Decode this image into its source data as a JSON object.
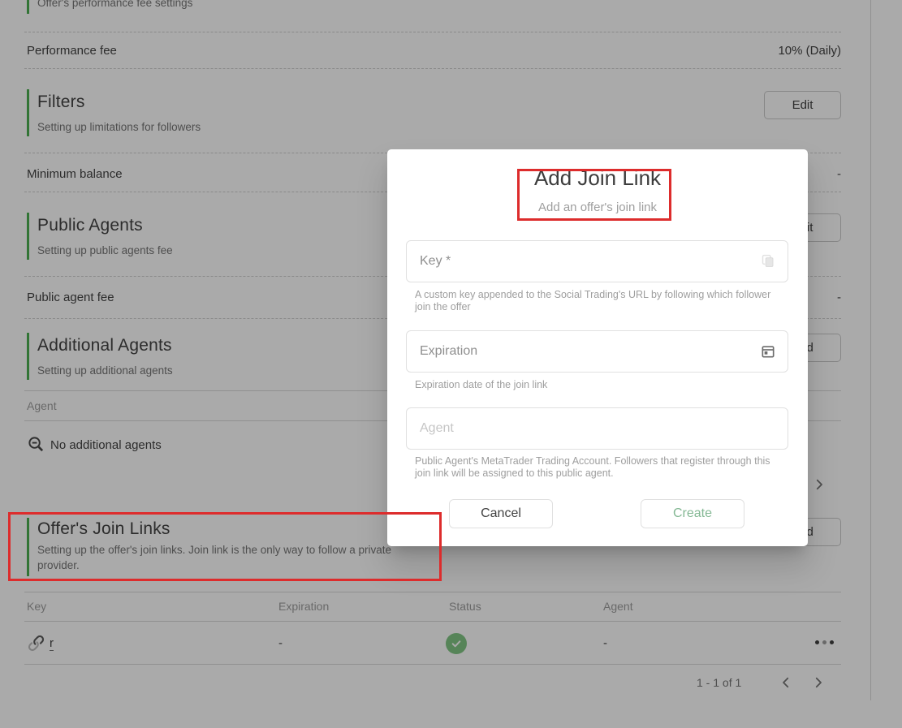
{
  "colors": {
    "section_accent_green": "#4caf50",
    "annotation_red": "#dd2c2c",
    "create_button_green": "#84b894",
    "status_check_green": "#81c784"
  },
  "page": {
    "top_section_subtitle": "Offer's performance fee settings",
    "performance_fee": {
      "label": "Performance fee",
      "value": "10% (Daily)"
    },
    "filters": {
      "title": "Filters",
      "subtitle": "Setting up limitations for followers",
      "button": "Edit"
    },
    "minimum_balance": {
      "label": "Minimum balance",
      "value": "-"
    },
    "public_agents": {
      "title": "Public Agents",
      "subtitle": "Setting up public agents fee",
      "button": "Edit"
    },
    "public_agent_fee": {
      "label": "Public agent fee",
      "value": "-"
    },
    "additional_agents": {
      "title": "Additional Agents",
      "subtitle": "Setting up additional agents",
      "button": "Add",
      "table": {
        "header": "Agent",
        "empty_text": "No additional agents"
      }
    },
    "offers_join_links": {
      "title": "Offer's Join Links",
      "subtitle": "Setting up the offer's join links. Join link is the only way to follow a private\nprovider.",
      "button": "Add",
      "table": {
        "headers": [
          "Key",
          "Expiration",
          "Status",
          "Agent"
        ],
        "row": {
          "key": "r",
          "expiration": "-",
          "status": "active",
          "agent": "-"
        }
      },
      "pagination": {
        "range": "1 - 1 of 1"
      }
    }
  },
  "modal": {
    "title": "Add Join Link",
    "subtitle": "Add an offer's join link",
    "key_field": {
      "label": "Key *",
      "helper": "A custom key appended to the Social Trading's URL by following which follower\njoin the offer"
    },
    "expiration_field": {
      "label": "Expiration",
      "helper": "Expiration date of the join link"
    },
    "agent_field": {
      "placeholder": "Agent",
      "helper": "Public Agent's MetaTrader Trading Account. Followers that register through this\njoin link will be assigned to this public agent."
    },
    "cancel_button": "Cancel",
    "create_button": "Create"
  }
}
